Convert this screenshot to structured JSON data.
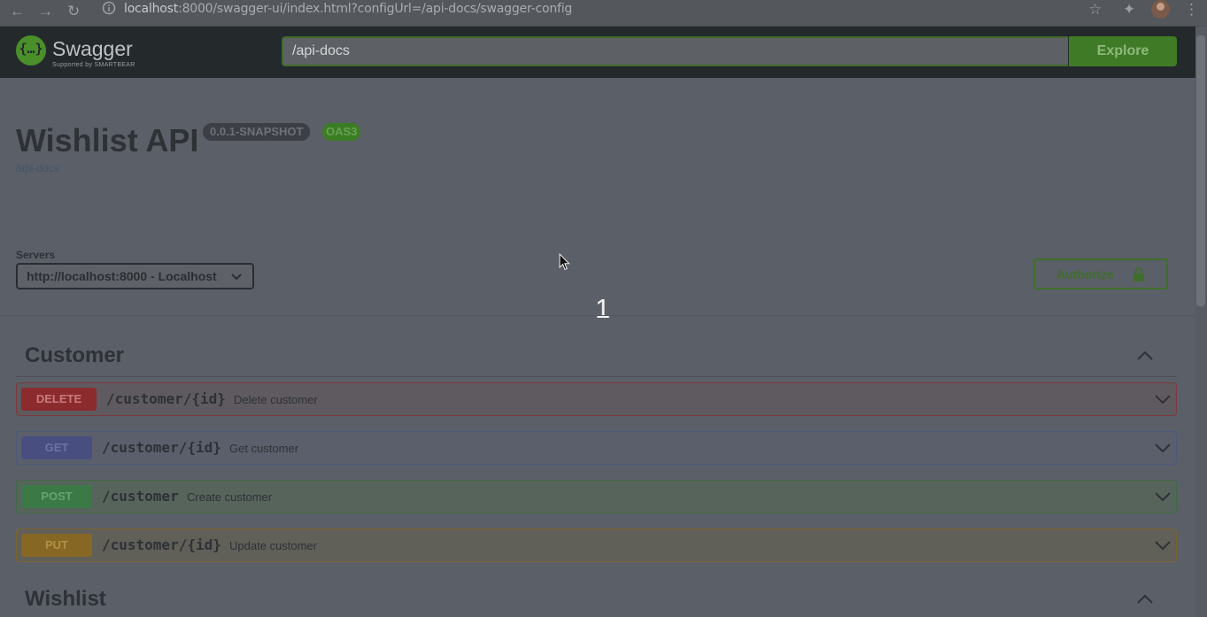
{
  "browser": {
    "url_host": "localhost",
    "url_rest": ":8000/swagger-ui/index.html?configUrl=/api-docs/swagger-config"
  },
  "topbar": {
    "logo_text": "Swagger",
    "logo_sub": "Supported by SMARTBEAR",
    "spec_url": "/api-docs",
    "explore_label": "Explore"
  },
  "info": {
    "title": "Wishlist API",
    "version": "0.0.1-SNAPSHOT",
    "oas_badge": "OAS3",
    "url": "/api-docs"
  },
  "servers": {
    "label": "Servers",
    "selected": "http://localhost:8000 - Localhost"
  },
  "authorize_label": "Authorize",
  "overlay_number": "1",
  "tags": [
    {
      "name": "Customer",
      "operations": [
        {
          "method": "DELETE",
          "path": "/customer/{id}",
          "summary": "Delete customer"
        },
        {
          "method": "GET",
          "path": "/customer/{id}",
          "summary": "Get customer"
        },
        {
          "method": "POST",
          "path": "/customer",
          "summary": "Create customer"
        },
        {
          "method": "PUT",
          "path": "/customer/{id}",
          "summary": "Update customer"
        }
      ]
    },
    {
      "name": "Wishlist",
      "operations": []
    }
  ],
  "colors": {
    "delete": "#f93e3e",
    "get": "#61affe",
    "post": "#49cc90",
    "put": "#fca130",
    "accent": "#49cc90"
  }
}
